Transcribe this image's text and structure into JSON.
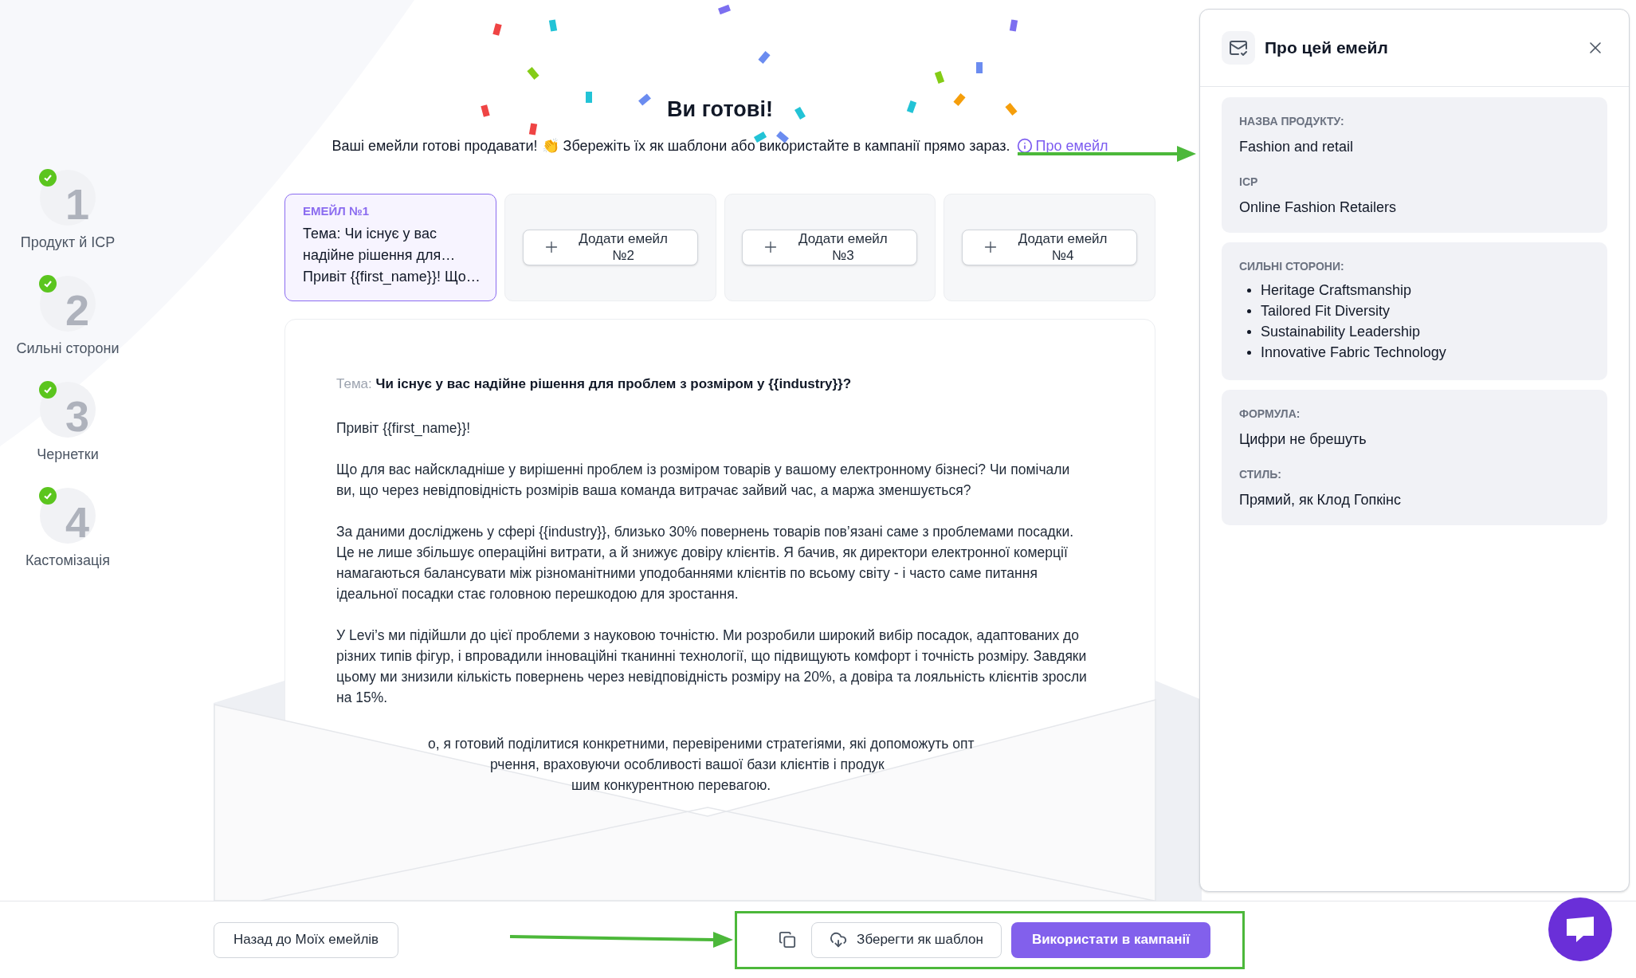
{
  "sidebar": {
    "steps": [
      {
        "number": "1",
        "label": "Продукт й ICP",
        "done": true
      },
      {
        "number": "2",
        "label": "Сильні сторони",
        "done": true
      },
      {
        "number": "3",
        "label": "Чернетки",
        "done": true
      },
      {
        "number": "4",
        "label": "Кастомізація",
        "done": true
      }
    ]
  },
  "header": {
    "title": "Ви готові!",
    "subtitle": "Ваші емейли готові продавати! 👏 Збережіть їх як шаблони або використайте в кампанії прямо зараз.",
    "about_link": "Про емейл"
  },
  "email_tabs": [
    {
      "kind": "email",
      "label": "ЕМЕЙЛ №1",
      "subject": "Тема: Чи існує у вас надійне рішення для…",
      "preview": "Привіт {{first_name}}! Що…",
      "selected": true
    },
    {
      "kind": "add",
      "label": "Додати емейл №2",
      "selected": false
    },
    {
      "kind": "add",
      "label": "Додати емейл №3",
      "selected": false
    },
    {
      "kind": "add",
      "label": "Додати емейл №4",
      "selected": false
    }
  ],
  "email": {
    "subject_label": "Тема:",
    "subject": "Чи існує у вас надійне рішення для проблем з розміром у {{industry}}?",
    "paragraphs": [
      "Привіт {{first_name}}!",
      "Що для вас найскладніше у вирішенні проблем із розміром товарів у вашому електронному бізнесі? Чи помічали ви, що через невідповідність розмірів ваша команда витрачає зайвий час, а маржа зменшується?",
      "За даними досліджень у сфері {{industry}}, близько 30% повернень товарів пов’язані саме з проблемами посадки. Це не лише збільшує операційні витрати, а й знижує довіру клієнтів. Я бачив, як директори електронної комерції намагаються балансувати між різноманітними уподобаннями клієнтів по всьому світу - і часто саме питання ідеальної посадки стає головною перешкодою для зростання.",
      "У Levi’s ми підійшли до цієї проблеми з науковою точністю. Ми розробили широкий вибір посадок, адаптованих до різних типів фігур, і впровадили інноваційні тканинні технології, що підвищують комфорт і точність розміру. Завдяки цьому ми знизили кількість повернень через невідповідність розміру на 20%, а довіра та лояльність клієнтів зросли на 15%."
    ],
    "partial_lines": [
      "о, я готовий поділитися конкретними, перевіреними стратегіями, які допоможуть опт",
      "рчення, враховуючи особливості вашої бази клієнтів і продук",
      "шим конкурентною перевагою."
    ]
  },
  "about_panel": {
    "title": "Про цей емейл",
    "sections": [
      {
        "kind": "fields",
        "fields": [
          {
            "label": "НАЗВА ПРОДУКТУ:",
            "value": "Fashion and retail"
          },
          {
            "label": "ICP",
            "value": "Online Fashion Retailers"
          }
        ]
      },
      {
        "kind": "list",
        "label": "СИЛЬНІ СТОРОНИ:",
        "items": [
          "Heritage Craftsmanship",
          "Tailored Fit Diversity",
          "Sustainability Leadership",
          "Innovative Fabric Technology"
        ]
      },
      {
        "kind": "fields",
        "fields": [
          {
            "label": "ФОРМУЛА:",
            "value": "Цифри не брешуть"
          },
          {
            "label": "СТИЛЬ:",
            "value": "Прямий, як Клод Гопкінс"
          }
        ]
      }
    ]
  },
  "footer": {
    "back_button": "Назад до Моїх емейлів",
    "save_template": "Зберегти як шаблон",
    "use_in_campaign": "Використати в кампанії"
  }
}
